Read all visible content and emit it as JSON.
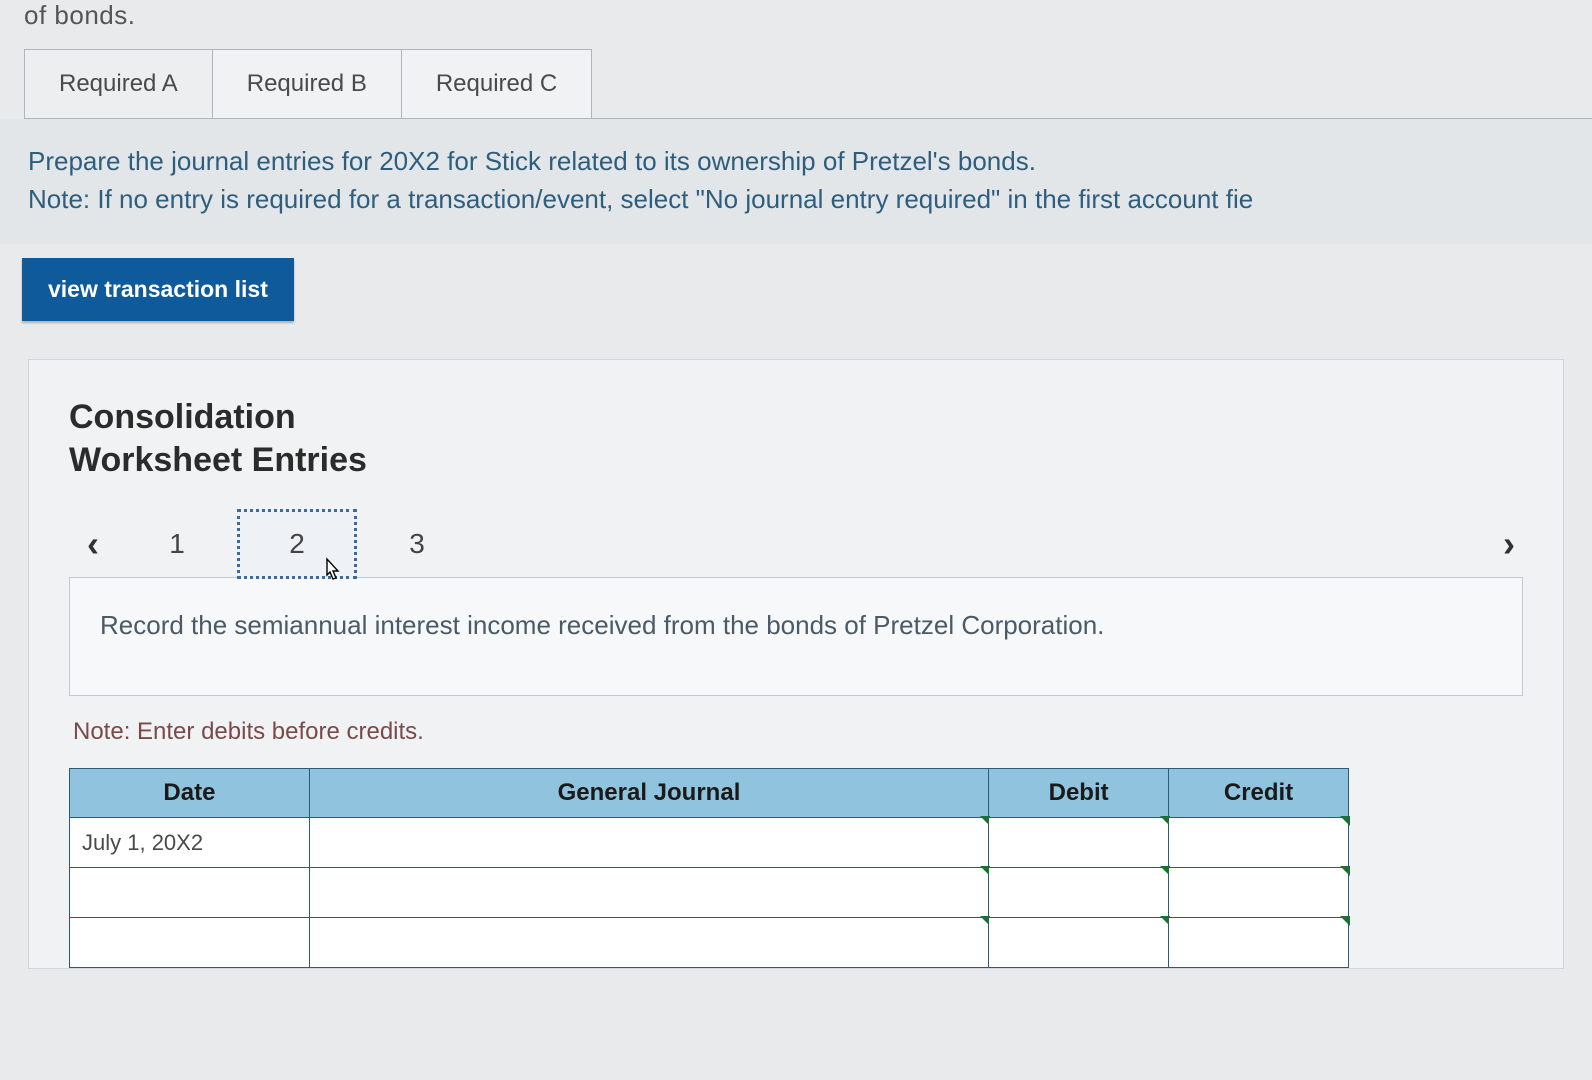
{
  "top_fragment": "of bonds.",
  "tabs": [
    {
      "label": "Required A",
      "active": true
    },
    {
      "label": "Required B",
      "active": false
    },
    {
      "label": "Required C",
      "active": false
    }
  ],
  "instruction": {
    "line1": "Prepare the journal entries for 20X2 for Stick related to its ownership of Pretzel's bonds.",
    "line2": "Note: If no entry is required for a transaction/event, select \"No journal entry required\" in the first account fie"
  },
  "view_button": "view transaction list",
  "panel_title_line1": "Consolidation",
  "panel_title_line2": "Worksheet Entries",
  "steps": [
    "1",
    "2",
    "3"
  ],
  "active_step": "2",
  "record_text": "Record the semiannual interest income received from the bonds of Pretzel Corporation.",
  "note_debits": "Note: Enter debits before credits.",
  "table": {
    "headers": {
      "date": "Date",
      "gj": "General Journal",
      "debit": "Debit",
      "credit": "Credit"
    },
    "rows": [
      {
        "date": "July 1, 20X2",
        "gj": "",
        "debit": "",
        "credit": ""
      },
      {
        "date": "",
        "gj": "",
        "debit": "",
        "credit": ""
      },
      {
        "date": "",
        "gj": "",
        "debit": "",
        "credit": ""
      }
    ]
  }
}
